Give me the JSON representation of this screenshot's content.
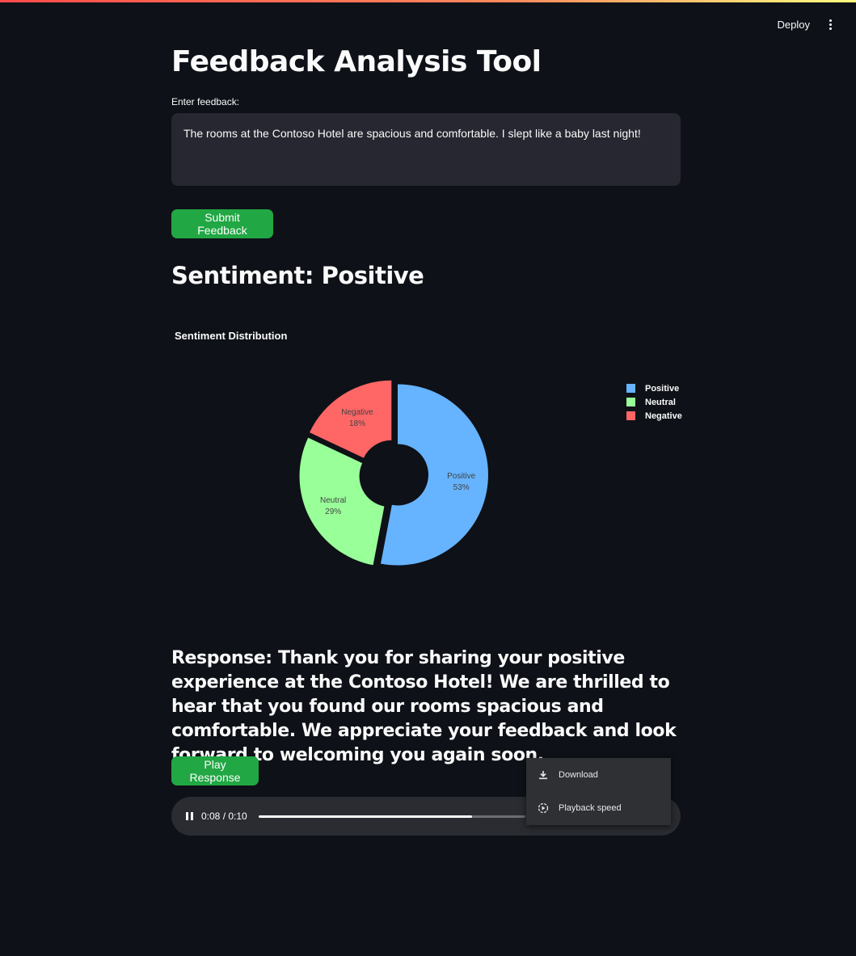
{
  "header": {
    "deploy_label": "Deploy"
  },
  "title": "Feedback Analysis Tool",
  "feedback": {
    "label": "Enter feedback:",
    "value": "The rooms at the Contoso Hotel are spacious and comfortable. I slept like a baby last night!"
  },
  "submit_label": "Submit Feedback",
  "sentiment_heading": "Sentiment: Positive",
  "chart_data": {
    "type": "pie",
    "title": "Sentiment Distribution",
    "hole": true,
    "slices": [
      {
        "label": "Positive",
        "value": 53,
        "text": "53%",
        "color": "#66b3ff"
      },
      {
        "label": "Neutral",
        "value": 29,
        "text": "29%",
        "color": "#99ff99"
      },
      {
        "label": "Negative",
        "value": 18,
        "text": "18%",
        "color": "#ff6666"
      }
    ],
    "legend": [
      "Positive",
      "Neutral",
      "Negative"
    ],
    "legend_position": "top-right"
  },
  "response_text": "Response: Thank you for sharing your positive experience at the Contoso Hotel! We are thrilled to hear that you found our rooms spacious and comfortable. We appreciate your feedback and look forward to welcoming you again soon.",
  "play_label": "Play Response",
  "audio": {
    "time": "0:08 / 0:10",
    "progress": 0.8
  },
  "context_menu": {
    "download_label": "Download",
    "speed_label": "Playback speed"
  }
}
